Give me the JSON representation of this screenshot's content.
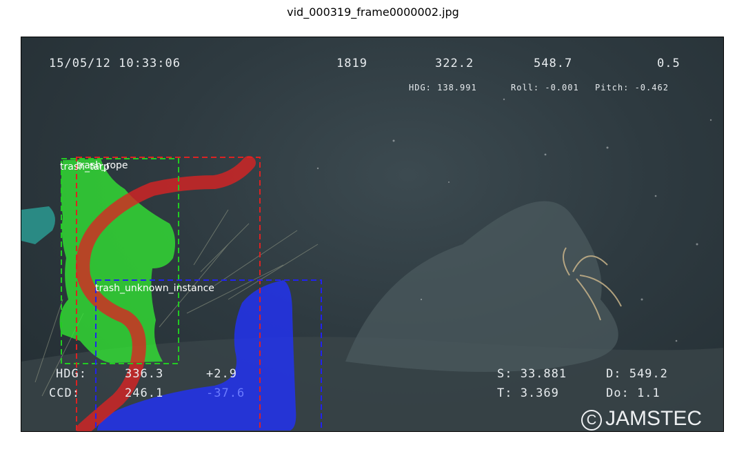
{
  "figure": {
    "title": "vid_000319_frame0000002.jpg"
  },
  "overlay": {
    "datetime": "15/05/12  10:33:06",
    "top_values": [
      "1819",
      "322.2",
      "548.7",
      "0.5"
    ],
    "hdg_line": "HDG: 138.991",
    "roll_line": "Roll: -0.001",
    "pitch_line": "Pitch: -0.462",
    "bl_row1": [
      "HDG:",
      "336.3",
      "+2.9"
    ],
    "bl_row2": [
      "CCD:",
      "246.1",
      "-37.6"
    ],
    "br_row1": [
      "S: 33.881",
      "D: 549.2"
    ],
    "br_row2": [
      "T:  3.369",
      "Do:  1.1"
    ],
    "watermark": "JAMSTEC",
    "watermark_symbol": "C"
  },
  "detections": [
    {
      "label": "trash_tarp",
      "color": "#22cc22"
    },
    {
      "label": "trash_rope",
      "color": "#dd2222"
    },
    {
      "label": "trash_unknown_instance",
      "color": "#2222ee"
    }
  ]
}
